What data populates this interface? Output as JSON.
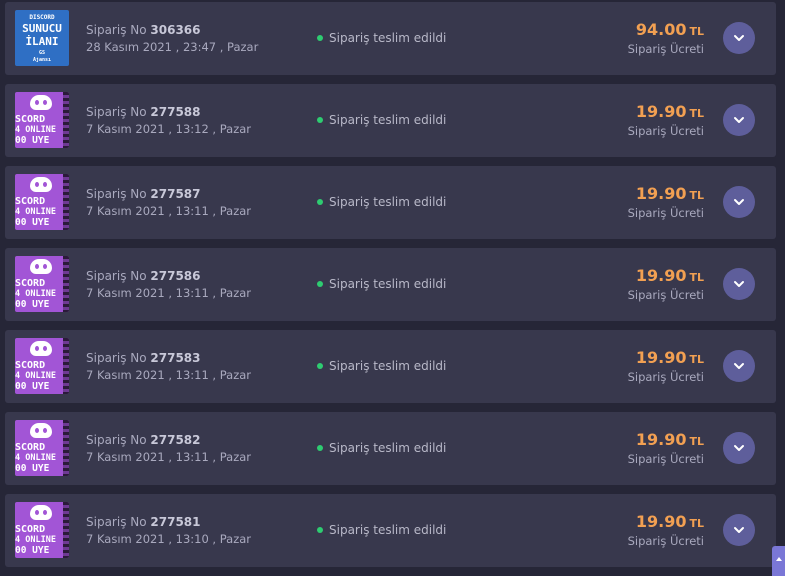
{
  "orders": [
    {
      "no_label": "Sipariş No",
      "number": "306366",
      "date": "28 Kasım 2021 , 23:47 , Pazar",
      "status": "Sipariş teslim edildi",
      "amount": "94.00",
      "currency": "TL",
      "fee_label": "Sipariş Ücreti",
      "thumb": "server",
      "thumb_lines": [
        "DISCORD",
        "SUNUCU",
        "İLANI",
        "GS",
        "Ajansı"
      ]
    },
    {
      "no_label": "Sipariş No",
      "number": "277588",
      "date": "7 Kasım 2021 , 13:12 , Pazar",
      "status": "Sipariş teslim edildi",
      "amount": "19.90",
      "currency": "TL",
      "fee_label": "Sipariş Ücreti",
      "thumb": "discord",
      "thumb_lines": [
        "SCORD",
        "4 ONLINE",
        "00 ÜYE"
      ]
    },
    {
      "no_label": "Sipariş No",
      "number": "277587",
      "date": "7 Kasım 2021 , 13:11 , Pazar",
      "status": "Sipariş teslim edildi",
      "amount": "19.90",
      "currency": "TL",
      "fee_label": "Sipariş Ücreti",
      "thumb": "discord",
      "thumb_lines": [
        "SCORD",
        "4 ONLINE",
        "00 ÜYE"
      ]
    },
    {
      "no_label": "Sipariş No",
      "number": "277586",
      "date": "7 Kasım 2021 , 13:11 , Pazar",
      "status": "Sipariş teslim edildi",
      "amount": "19.90",
      "currency": "TL",
      "fee_label": "Sipariş Ücreti",
      "thumb": "discord",
      "thumb_lines": [
        "SCORD",
        "4 ONLINE",
        "00 ÜYE"
      ]
    },
    {
      "no_label": "Sipariş No",
      "number": "277583",
      "date": "7 Kasım 2021 , 13:11 , Pazar",
      "status": "Sipariş teslim edildi",
      "amount": "19.90",
      "currency": "TL",
      "fee_label": "Sipariş Ücreti",
      "thumb": "discord",
      "thumb_lines": [
        "SCORD",
        "4 ONLINE",
        "00 ÜYE"
      ]
    },
    {
      "no_label": "Sipariş No",
      "number": "277582",
      "date": "7 Kasım 2021 , 13:11 , Pazar",
      "status": "Sipariş teslim edildi",
      "amount": "19.90",
      "currency": "TL",
      "fee_label": "Sipariş Ücreti",
      "thumb": "discord",
      "thumb_lines": [
        "SCORD",
        "4 ONLINE",
        "00 ÜYE"
      ]
    },
    {
      "no_label": "Sipariş No",
      "number": "277581",
      "date": "7 Kasım 2021 , 13:10 , Pazar",
      "status": "Sipariş teslim edildi",
      "amount": "19.90",
      "currency": "TL",
      "fee_label": "Sipariş Ücreti",
      "thumb": "discord",
      "thumb_lines": [
        "SCORD",
        "4 ONLINE",
        "00 ÜYE"
      ]
    }
  ],
  "icons": {
    "expand": "chevron-down-icon",
    "status": "status-dot-icon",
    "scroll": "chevron-up-icon"
  },
  "colors": {
    "background": "#262637",
    "card": "#38384d",
    "price": "#f2a052",
    "status_dot": "#2ecc71",
    "expand_button": "#5e5e9b",
    "scroll_button": "#7a77d6",
    "thumb_server": "#2f6fc4",
    "thumb_discord": "#a255d6"
  }
}
